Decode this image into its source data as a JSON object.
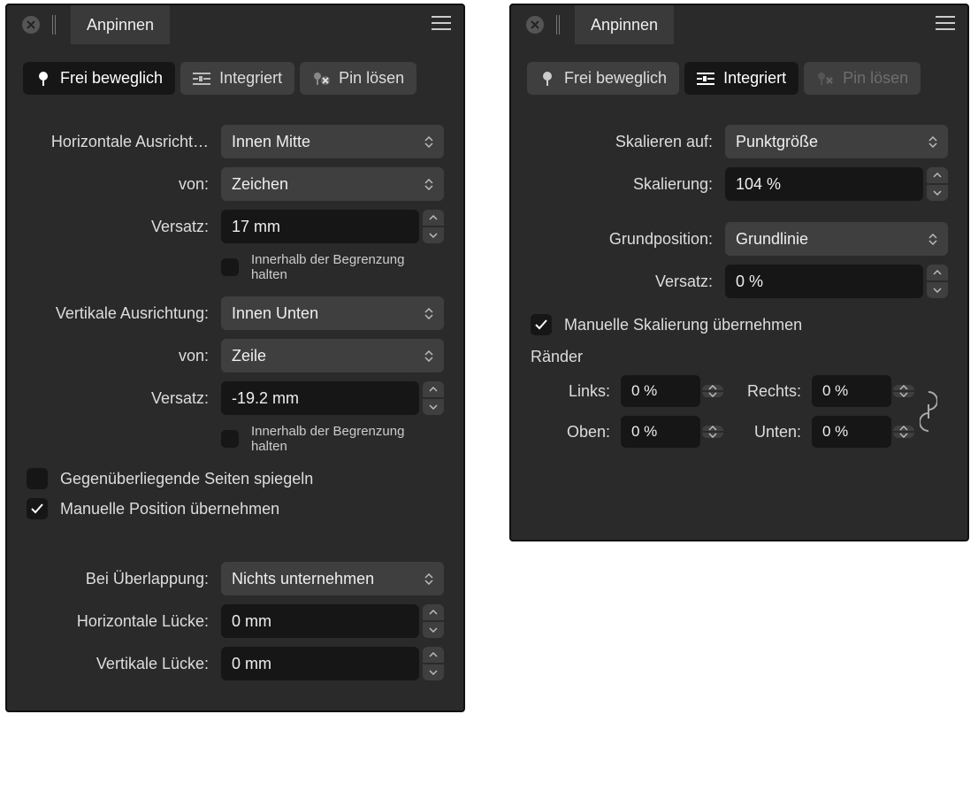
{
  "panel_title": "Anpinnen",
  "tabs": {
    "free": "Frei beweglich",
    "inline": "Integriert",
    "unpin": "Pin lösen"
  },
  "left": {
    "h_align_label": "Horizontale Ausricht…",
    "h_align_value": "Innen Mitte",
    "from_label": "von:",
    "h_from_value": "Zeichen",
    "offset_label": "Versatz:",
    "h_offset_value": "17 mm",
    "keep_within": "Innerhalb der Begrenzung halten",
    "v_align_label": "Vertikale Ausrichtung:",
    "v_align_value": "Innen Unten",
    "v_from_value": "Zeile",
    "v_offset_value": "-19.2 mm",
    "mirror_facing": "Gegenüberliegende Seiten spiegeln",
    "manual_pos": "Manuelle Position übernehmen",
    "overlap_label": "Bei Überlappung:",
    "overlap_value": "Nichts unternehmen",
    "hgap_label": "Horizontale Lücke:",
    "hgap_value": "0 mm",
    "vgap_label": "Vertikale Lücke:",
    "vgap_value": "0 mm"
  },
  "right": {
    "scale_to_label": "Skalieren auf:",
    "scale_to_value": "Punktgröße",
    "scale_label": "Skalierung:",
    "scale_value": "104 %",
    "base_label": "Grundposition:",
    "base_value": "Grundlinie",
    "offset_label": "Versatz:",
    "offset_value": "0 %",
    "manual_scale": "Manuelle Skalierung übernehmen",
    "margins_header": "Ränder",
    "m_left_label": "Links:",
    "m_left": "0 %",
    "m_right_label": "Rechts:",
    "m_right": "0 %",
    "m_top_label": "Oben:",
    "m_top": "0 %",
    "m_bottom_label": "Unten:",
    "m_bottom": "0 %"
  }
}
